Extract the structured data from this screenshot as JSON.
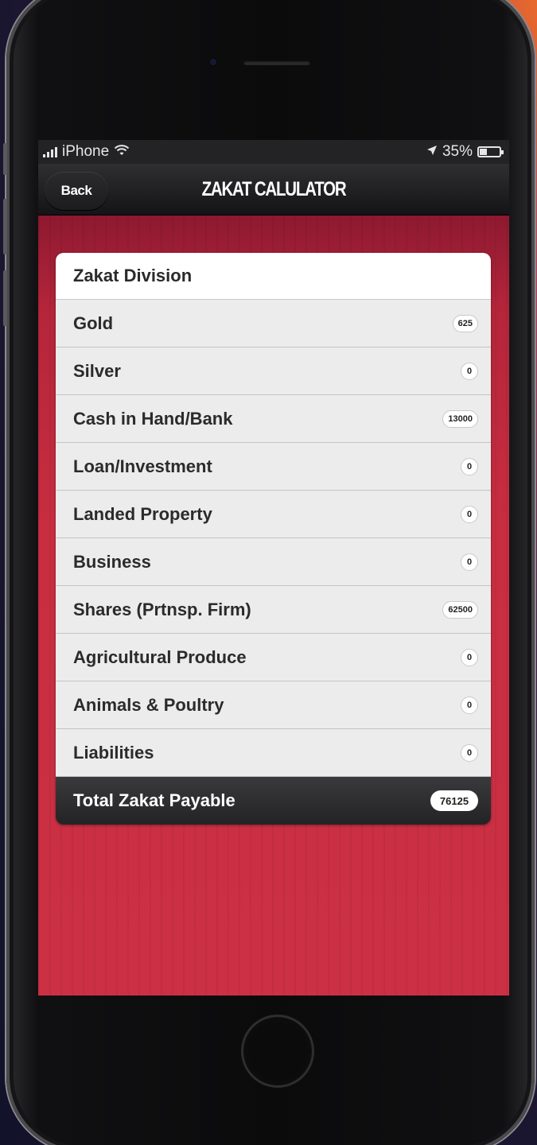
{
  "status_bar": {
    "carrier": "iPhone",
    "battery": "35%",
    "icons": [
      "signal-icon",
      "wifi-icon",
      "location-icon",
      "battery-icon"
    ]
  },
  "nav": {
    "back_label": "Back",
    "title": "ZAKAT CALULATOR"
  },
  "list": {
    "header": "Zakat Division",
    "items": [
      {
        "label": "Gold",
        "value": "625"
      },
      {
        "label": "Silver",
        "value": "0"
      },
      {
        "label": "Cash in Hand/Bank",
        "value": "13000"
      },
      {
        "label": "Loan/Investment",
        "value": "0"
      },
      {
        "label": "Landed Property",
        "value": "0"
      },
      {
        "label": "Business",
        "value": "0"
      },
      {
        "label": "Shares (Prtnsp. Firm)",
        "value": "62500"
      },
      {
        "label": "Agricultural Produce",
        "value": "0"
      },
      {
        "label": "Animals & Poultry",
        "value": "0"
      },
      {
        "label": "Liabilities",
        "value": "0"
      }
    ],
    "total": {
      "label": "Total Zakat Payable",
      "value": "76125"
    }
  },
  "colors": {
    "screen_background": "#c72c3f",
    "nav_bar": "#1f1f22",
    "list_item": "#ececec",
    "total_row": "#2c2c2e"
  },
  "battery_level": 0.35
}
